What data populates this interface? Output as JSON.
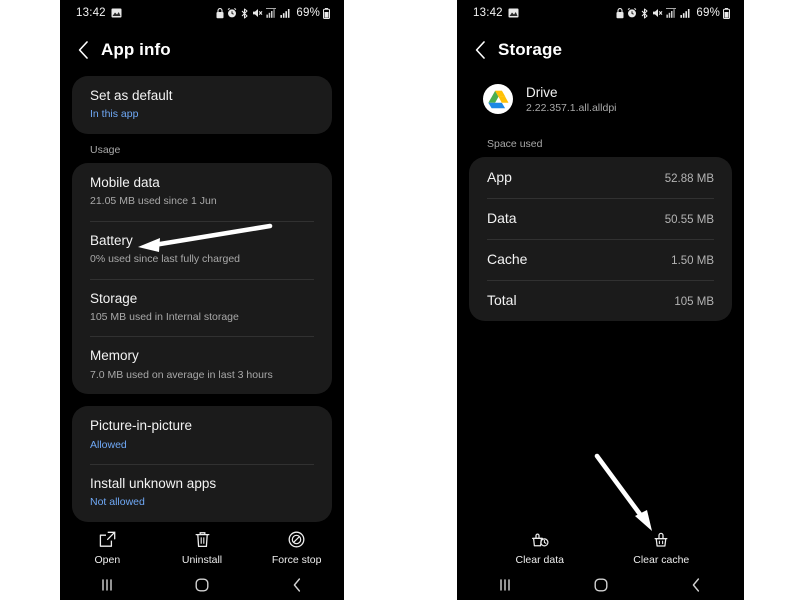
{
  "status_bar": {
    "time": "13:42",
    "battery": "69%",
    "icons": [
      "screenshot-icon",
      "lock-icon",
      "alarm-icon",
      "bluetooth-icon",
      "mute-icon",
      "network-signal-icon",
      "cellular-signal-icon",
      "battery-icon"
    ]
  },
  "left_screen": {
    "title": "App info",
    "back_label": "Back",
    "cards": [
      {
        "rows": [
          {
            "title": "Set as default",
            "sub": "In this app",
            "sub_style": "link"
          }
        ]
      }
    ],
    "usage_label": "Usage",
    "usage_rows": [
      {
        "title": "Mobile data",
        "sub": "21.05 MB used since 1 Jun"
      },
      {
        "title": "Battery",
        "sub": "0% used since last fully charged"
      },
      {
        "title": "Storage",
        "sub": "105 MB used in Internal storage"
      },
      {
        "title": "Memory",
        "sub": "7.0 MB used on average in last 3 hours"
      }
    ],
    "permission_rows": [
      {
        "title": "Picture-in-picture",
        "sub": "Allowed",
        "sub_style": "link"
      },
      {
        "title": "Install unknown apps",
        "sub": "Not allowed",
        "sub_style": "link"
      }
    ],
    "actions": [
      {
        "label": "Open",
        "icon": "external-link-icon"
      },
      {
        "label": "Uninstall",
        "icon": "trash-icon"
      },
      {
        "label": "Force stop",
        "icon": "force-stop-icon"
      }
    ]
  },
  "right_screen": {
    "title": "Storage",
    "back_label": "Back",
    "app": {
      "name": "Drive",
      "version": "2.22.357.1.all.alldpi",
      "icon": "google-drive-icon"
    },
    "space_used_label": "Space used",
    "storage_rows": [
      {
        "label": "App",
        "value": "52.88 MB"
      },
      {
        "label": "Data",
        "value": "50.55 MB"
      },
      {
        "label": "Cache",
        "value": "1.50 MB"
      },
      {
        "label": "Total",
        "value": "105 MB"
      }
    ],
    "actions": [
      {
        "label": "Clear data",
        "icon": "clear-data-icon"
      },
      {
        "label": "Clear cache",
        "icon": "clear-cache-icon"
      }
    ]
  },
  "nav_bar": {
    "recents": "recents-icon",
    "home": "home-icon",
    "back": "back-icon"
  },
  "annotations": [
    {
      "name": "arrow-to-storage",
      "target": "Storage"
    },
    {
      "name": "arrow-to-clear-cache",
      "target": "Clear cache"
    }
  ],
  "colors": {
    "background": "#000000",
    "card": "#1b1b1b",
    "accent_link": "#6fa8f5",
    "text_primary": "#f3f3f3",
    "text_secondary": "#a9a9a9",
    "annotation": "#ffffff"
  }
}
